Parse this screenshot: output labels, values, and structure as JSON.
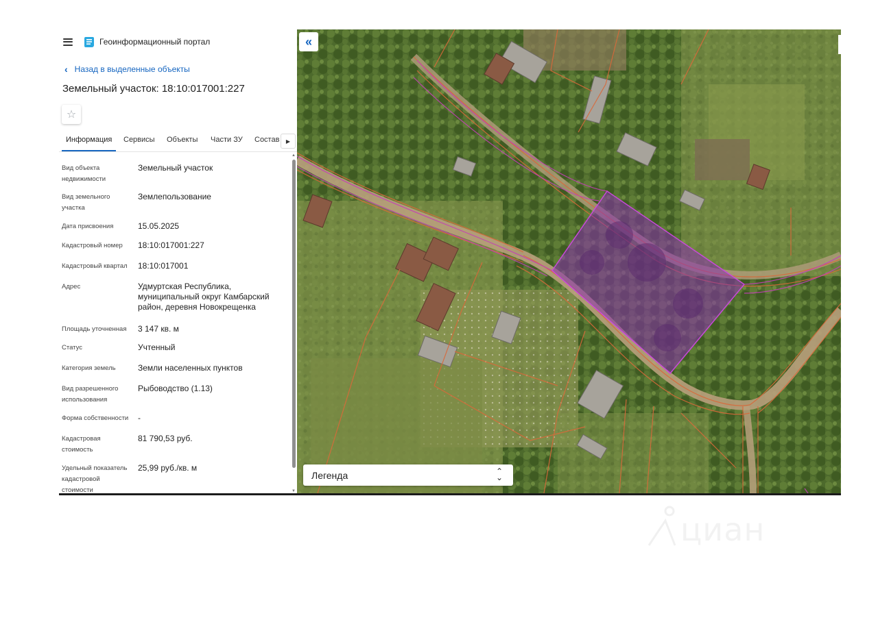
{
  "header": {
    "portal_title": "Геоинформационный портал"
  },
  "nav": {
    "back_label": "Назад в выделенные объекты"
  },
  "object": {
    "title": "Земельный участок: 18:10:017001:227"
  },
  "tabs": [
    {
      "label": "Информация",
      "active": true
    },
    {
      "label": "Сервисы"
    },
    {
      "label": "Объекты"
    },
    {
      "label": "Части ЗУ"
    },
    {
      "label": "Состав"
    }
  ],
  "info_rows": [
    {
      "label": "Вид объекта недвижимости",
      "value": "Земельный участок"
    },
    {
      "label": "Вид земельного участка",
      "value": "Землепользование"
    },
    {
      "label": "Дата присвоения",
      "value": "15.05.2025"
    },
    {
      "label": "Кадастровый номер",
      "value": "18:10:017001:227"
    },
    {
      "label": "Кадастровый квартал",
      "value": "18:10:017001"
    },
    {
      "label": "Адрес",
      "value": "Удмуртская Республика, муниципальный округ Камбарский район, деревня Новокрещенка"
    },
    {
      "label": "Площадь уточненная",
      "value": "3 147 кв. м"
    },
    {
      "label": "Статус",
      "value": "Учтенный"
    },
    {
      "label": "Категория земель",
      "value": "Земли населенных пунктов"
    },
    {
      "label": "Вид разрешенного использования",
      "value": "Рыбоводство (1.13)"
    },
    {
      "label": "Форма собственности",
      "value": "-"
    },
    {
      "label": "Кадастровая стоимость",
      "value": "81 790,53 руб."
    },
    {
      "label": "Удельный показатель кадастровой стоимости",
      "value": "25,99 руб./кв. м"
    }
  ],
  "map": {
    "legend_label": "Легенда",
    "parcel_color": "#b03ad0",
    "boundary_color": "#d9693a"
  },
  "watermark": {
    "text": "циан"
  },
  "icons": {
    "menu": "hamburger-icon",
    "logo": "portal-logo-icon",
    "back": "chevron-left-icon",
    "favorite": "star-outline-icon",
    "tabs_next": "triangle-right-icon",
    "collapse": "double-chevron-left-icon",
    "legend_toggle": "updown-chevron-icon"
  }
}
